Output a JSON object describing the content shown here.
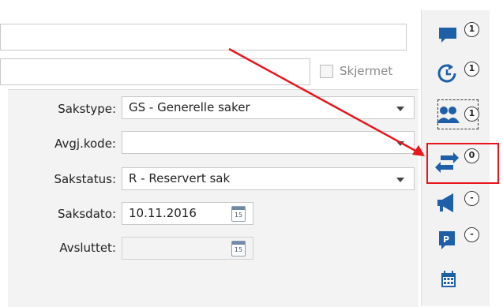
{
  "form": {
    "skjermet_label": "Skjermet",
    "rows": [
      {
        "label": "Sakstype:",
        "value": "GS - Generelle saker"
      },
      {
        "label": "Avgj.kode:",
        "value": ""
      },
      {
        "label": "Sakstatus:",
        "value": "R - Reservert sak"
      }
    ],
    "saksdato": {
      "label": "Saksdato:",
      "value": "10.11.2016"
    },
    "avsluttet": {
      "label": "Avsluttet:",
      "value": ""
    },
    "calendar_day": "15"
  },
  "sidebar": {
    "buttons": [
      {
        "icon": "comment-icon",
        "badge": "1"
      },
      {
        "icon": "history-icon",
        "badge": "1"
      },
      {
        "icon": "users-icon",
        "badge": "1"
      },
      {
        "icon": "transfer-icon",
        "badge": "0"
      },
      {
        "icon": "megaphone-icon",
        "badge": "-"
      },
      {
        "icon": "parking-sign-icon",
        "badge": "-"
      },
      {
        "icon": "calendar-icon",
        "badge": ""
      }
    ]
  },
  "colors": {
    "accent": "#1f5fa8",
    "highlight": "#e8151b"
  }
}
